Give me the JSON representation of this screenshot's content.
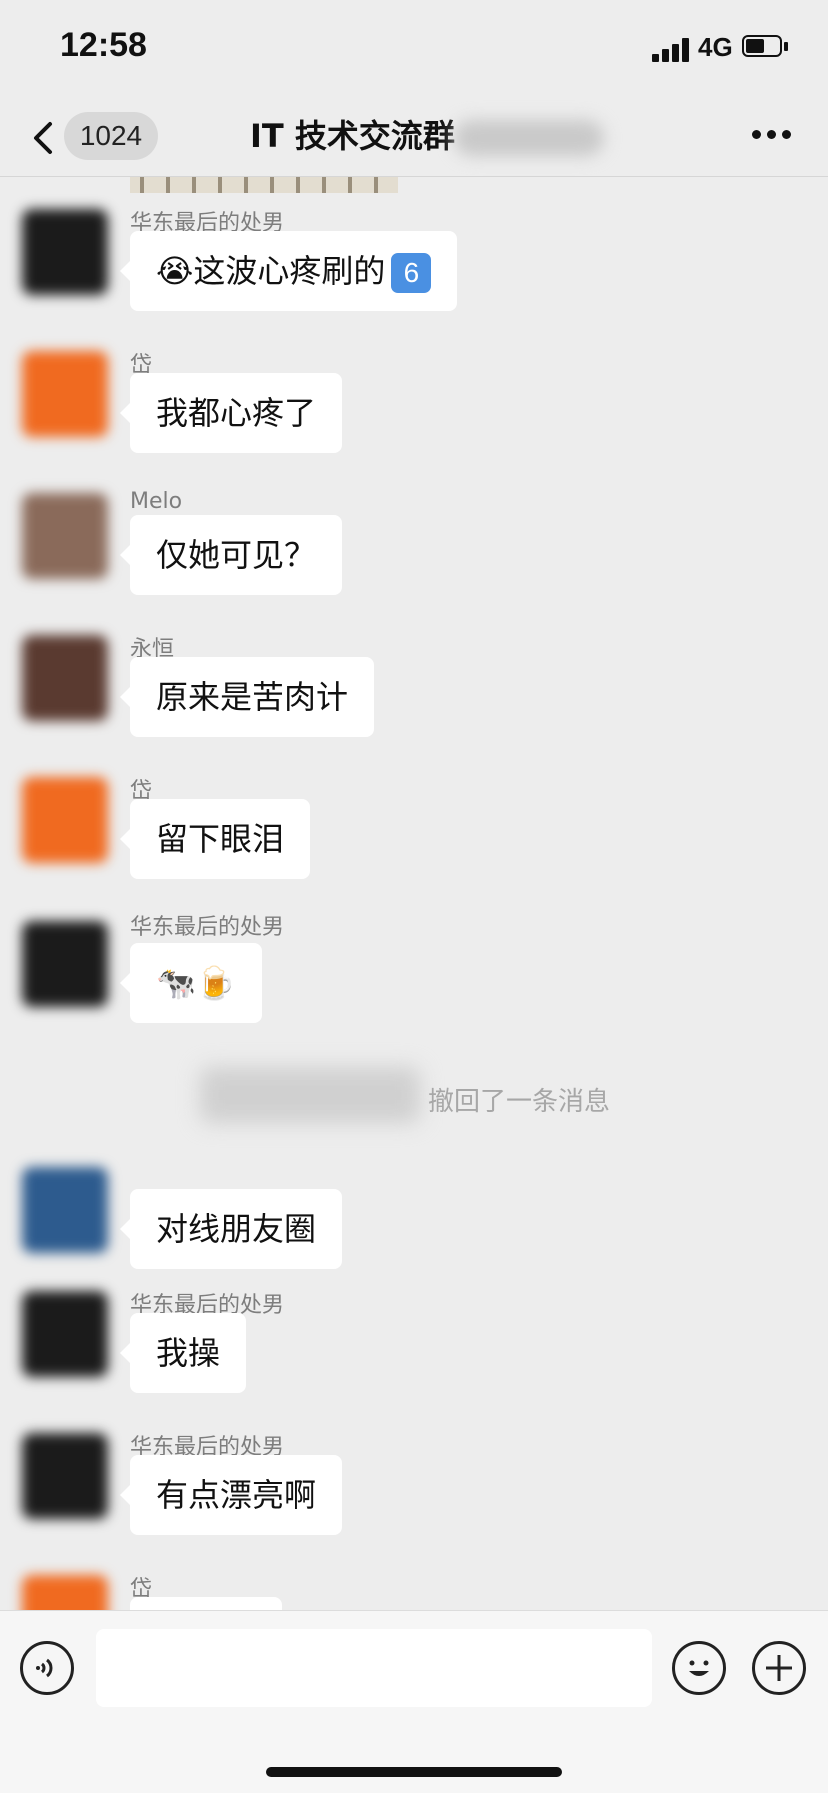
{
  "status_bar": {
    "time": "12:58",
    "network": "4G"
  },
  "nav": {
    "back_icon": "chevron-left-icon",
    "unread_count": "1024",
    "title": "IT 技术交流群",
    "more_icon": "more-dots-icon"
  },
  "messages": [
    {
      "sender": "华东最后的处男",
      "text": "😭这波心疼刷的",
      "badge": "6"
    },
    {
      "sender": "岱",
      "text": "我都心疼了"
    },
    {
      "sender": "Melo",
      "text": "仅她可见？"
    },
    {
      "sender": "永恒",
      "text": "原来是苦肉计"
    },
    {
      "sender": "岱",
      "text": "留下眼泪"
    },
    {
      "sender": "华东最后的处男",
      "text": "🐄🍺"
    },
    {
      "system": "撤回了一条消息"
    },
    {
      "sender": "",
      "text": "对线朋友圈"
    },
    {
      "sender": "华东最后的处男",
      "text": "我操"
    },
    {
      "sender": "华东最后的处男",
      "text": "有点漂亮啊"
    },
    {
      "sender": "岱",
      "text": ""
    }
  ],
  "input_bar": {
    "voice_icon": "voice-icon",
    "input_value": "",
    "emoji_icon": "smile-icon",
    "plus_icon": "plus-icon"
  },
  "colors": {
    "background": "#ededed",
    "bubble": "#ffffff",
    "badge_blue": "#4a90e2"
  }
}
